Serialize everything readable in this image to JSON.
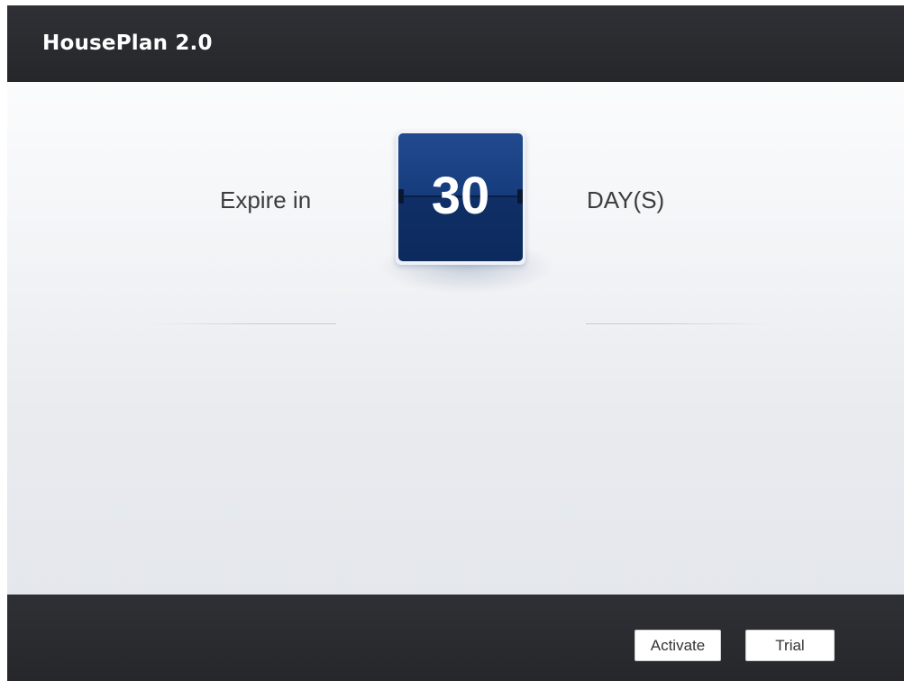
{
  "window": {
    "title": "HousePlan 2.0"
  },
  "license": {
    "expire_label": "Expire in",
    "days_remaining": "30",
    "unit_label": "DAY(S)"
  },
  "footer": {
    "activate_label": "Activate",
    "trial_label": "Trial"
  },
  "colors": {
    "bar_background": "#2b2c30",
    "counter_blue": "#163c7c",
    "text": "#3c3c3c"
  }
}
